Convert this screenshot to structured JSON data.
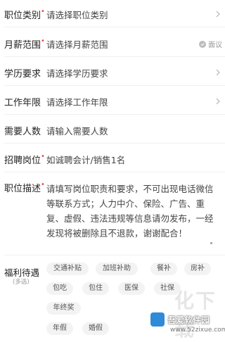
{
  "form": {
    "rows": [
      {
        "label": "职位类别",
        "required": true,
        "value": "请选择职位类别"
      },
      {
        "label": "月薪范围",
        "required": true,
        "value": "请选择月薪范围",
        "tag": "面议"
      },
      {
        "label": "学历要求",
        "required": false,
        "value": "请选择学历要求"
      },
      {
        "label": "工作年限",
        "required": false,
        "value": "请选择工作年限"
      },
      {
        "label": "需要人数",
        "required": false,
        "value": "请输入需要人数"
      },
      {
        "label": "招聘岗位",
        "required": true,
        "value": "如诚聘会计/销售1名"
      },
      {
        "label": "职位描述",
        "required": true,
        "value": "请填写岗位职责和要求，不可出现电话微信等联系方式；人力中介、保险、广告、重复、虚假、违法违规等信息请勿发布，一经发现将被删除且不退款，谢谢配合！"
      }
    ]
  },
  "benefits": {
    "title": "福利待遇",
    "subtitle": "(多选)",
    "tags": [
      "交通补贴",
      "加班补助",
      "餐补",
      "房补",
      "包吃",
      "包住",
      "医保",
      "社保",
      "年终奖",
      "年假",
      "婚假"
    ]
  },
  "watermark": {
    "name": "吾爱软件园",
    "url": "www.52zixue.com"
  }
}
